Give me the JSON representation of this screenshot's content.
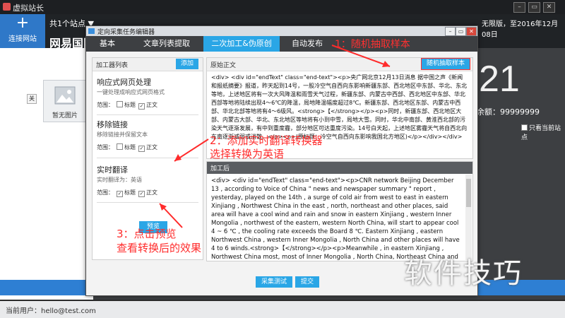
{
  "app": {
    "title": "虚拟站长",
    "connect_label": "连接网站",
    "sites_label": "共1个站点",
    "license": "无限版，至2016年12月08日",
    "site_heading": "网易国际",
    "site_link": "http://test",
    "no_image_label": "暂无图片",
    "close_label": "关",
    "big_number": "21",
    "balance": "今日余额：99999999",
    "only_current": "只看当前站点",
    "status_user": "当前用户：hello@test.com"
  },
  "dialog": {
    "title": "定向采集任务编辑器",
    "tabs": [
      {
        "label": "基本"
      },
      {
        "label": "文章列表提取"
      },
      {
        "label": "二次加工&伪原创"
      },
      {
        "label": "自动发布"
      }
    ],
    "active_tab": 2,
    "processor_list": {
      "header": "加工器列表",
      "add_button": "添加",
      "items": [
        {
          "name": "响应式网页处理",
          "desc": "一键处理成响应式网页格式",
          "range_label": "范围：",
          "opt1": "标题",
          "opt2": "正文"
        },
        {
          "name": "移除链接",
          "desc": "移除链接并保留文本",
          "range_label": "范围：",
          "opt1": "标题",
          "opt2": "正文"
        },
        {
          "name": "实时翻译",
          "desc": "实时翻译为：英语",
          "range_label": "范围：",
          "opt1": "标题",
          "opt2": "正文"
        }
      ],
      "preview_button": "预览"
    },
    "original": {
      "header": "原始正文",
      "random_button": "随机抽取样本",
      "text": "<div> <div id=\"endText\" class=\"end-text\"><p>央广网北京12月13日消息 据中国之声《新闻和报纸摘要》报道，昨天起到14号，一股冷空气自西向东影响新疆东部、西北地区中东部、华北、东北等地，上述地区将有一次大风降温和雨雪天气过程，新疆东部、内蒙古中西部、西北地区中东部、华北西部等地将陆续出现4～6℃的降温，局地降温幅度超过8℃。新疆东部、西北地区东部、内蒙古中西部、华北北部等地将有4～6级风。<strong>【</strong></p><p>同时，新疆东部、西北地区大部、内蒙古大部、华北、东北地区等地将有小到中雪，局地大雪。同时，华北中南部、黄淮西北部的污染天气逐渐发展，有中到重度霾，部分地区可达重度污染。14号白天起，上述地区雾霾天气将自西北向东南逐渐减弱或消散。</p><p>(原标题：冷空气自西向东影响我国北方地区)</p></div></div>"
    },
    "after": {
      "header": "加工后",
      "text": "<div> <div id=\"endText\" class=\"end-text\"><p>CNR network Beijing December 13 , according to Voice of China \" news and newspaper summary \" report , yesterday, played on the 14th , a surge of cold air from west to east in eastern Xinjiang , Northwest China in the east , north, northeast and other places, said area will have a cool wind and rain and snow in eastern Xinjiang , western Inner Mongolia , northwest of the eastern, western North China, will start to appear cool 4 ~ 6 ℃ , the cooling rate exceeds the Board 8 ℃. Eastern Xinjiang , eastern Northwest China , western Inner Mongolia , North China and other places will have 4 to 6 winds.<strong>【</strong></p><p>Meanwhile , in eastern Xinjiang , Northwest China most, most of Inner Mongolia , North China, Northeast China and other places will have small to moderate snow , the Council to heavy snow . At the same time, the central and southern North China , Huang-Huai northwest contamination weather developing, with moderate to severe haze in some areas up to heavy"
    },
    "collect_test_button": "采集测试",
    "submit_button": "提交"
  },
  "annotations": {
    "step1": "1：随机抽取样本",
    "step2_line1": "2：添加实时翻译转换器",
    "step2_line2": "选择转换为英语",
    "step3_line1": "3：点击预览",
    "step3_line2": "查看转换后的效果"
  },
  "watermark": "软件技巧",
  "colors": {
    "accent": "#2aa6e6",
    "annotation": "#ff2b2b",
    "connect": "#2f78c8"
  }
}
